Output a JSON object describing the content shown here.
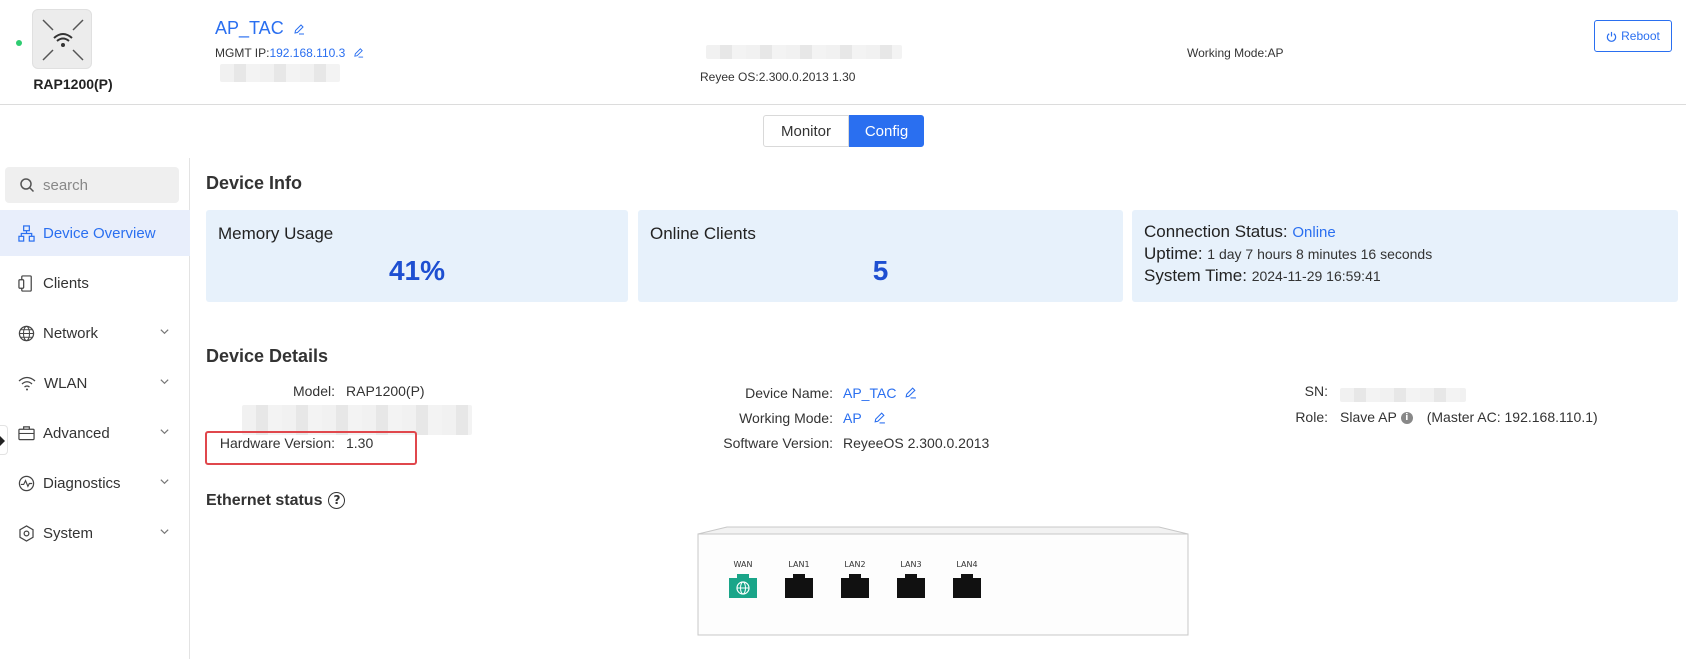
{
  "header": {
    "device_model": "RAP1200(P)",
    "hostname": "AP_TAC",
    "mgmt_ip_label": "MGMT IP:",
    "mgmt_ip": "192.168.110.3",
    "os_version": "Reyee OS:2.300.0.2013 1.30",
    "working_mode": "Working Mode:AP",
    "reboot_label": "Reboot"
  },
  "tabs": [
    {
      "label": "Monitor",
      "active": false
    },
    {
      "label": "Config",
      "active": true
    }
  ],
  "sidebar": {
    "search_placeholder": "search",
    "items": [
      {
        "label": "Device Overview",
        "icon": "topology-icon",
        "active": true
      },
      {
        "label": "Clients",
        "icon": "clients-icon"
      },
      {
        "label": "Network",
        "icon": "globe-icon"
      },
      {
        "label": "WLAN",
        "icon": "wifi-icon"
      },
      {
        "label": "Advanced",
        "icon": "briefcase-icon"
      },
      {
        "label": "Diagnostics",
        "icon": "diagnostics-icon"
      },
      {
        "label": "System",
        "icon": "gear-icon"
      }
    ]
  },
  "device_info": {
    "title": "Device Info",
    "memory_label": "Memory Usage",
    "memory_value": "41%",
    "clients_label": "Online Clients",
    "clients_value": "5",
    "connection_label": "Connection Status: ",
    "connection_value": "Online",
    "uptime_label": "Uptime: ",
    "uptime_value": "1 day 7 hours 8 minutes 16 seconds",
    "system_time_label": "System Time: ",
    "system_time_value": "2024-11-29 16:59:41"
  },
  "device_details": {
    "title": "Device Details",
    "model_label": "Model:",
    "model_value": "RAP1200(P)",
    "hw_label": "Hardware Version:",
    "hw_value": "1.30",
    "name_label": "Device Name:",
    "name_value": "AP_TAC",
    "mode_label": "Working Mode:",
    "mode_value": "AP",
    "sw_label": "Software Version:",
    "sw_value": "ReyeeOS 2.300.0.2013",
    "sn_label": "SN:",
    "role_label": "Role:",
    "role_value": "Slave AP",
    "master_ac": "(Master AC:  192.168.110.1)"
  },
  "ethernet": {
    "title": "Ethernet status",
    "ports": [
      {
        "label": "WAN",
        "type": "wan",
        "color": "#1aa589"
      },
      {
        "label": "LAN1",
        "type": "lan"
      },
      {
        "label": "LAN2",
        "type": "lan"
      },
      {
        "label": "LAN3",
        "type": "lan"
      },
      {
        "label": "LAN4",
        "type": "lan"
      }
    ]
  },
  "colors": {
    "accent": "#2a6ff0",
    "card_bg": "#e7f1fb",
    "value_blue": "#1e4fd1",
    "highlight_red": "#e0474c",
    "online_green": "#2ecc71"
  }
}
